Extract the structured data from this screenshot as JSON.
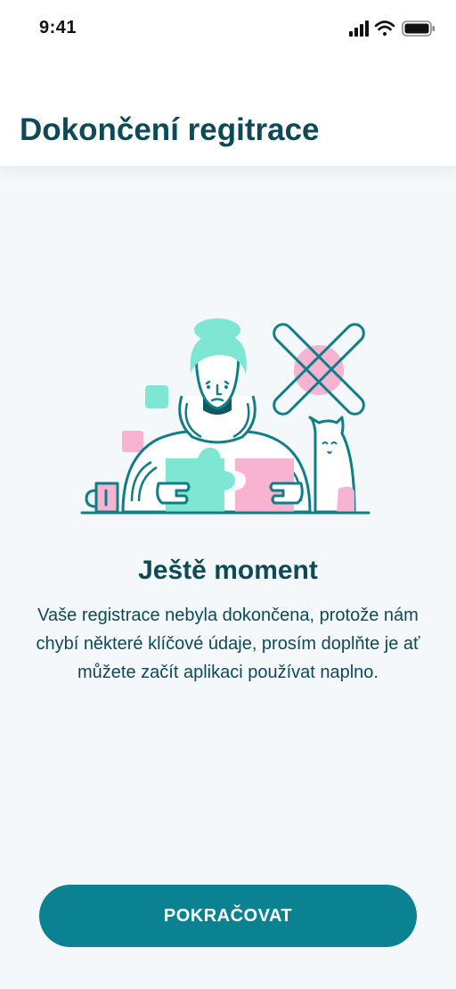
{
  "status_bar": {
    "time": "9:41",
    "icons": [
      "cellular-signal-icon",
      "wifi-icon",
      "battery-icon"
    ]
  },
  "header": {
    "title": "Dokončení regitrace"
  },
  "illustration": {
    "icon": "person-with-puzzle-and-cat-illustration"
  },
  "content": {
    "headline": "Ještě moment",
    "description": "Vaše registrace nebyla dokončena, protože nám chybí některé klíčové údaje, prosím doplňte je ať můžete začít aplikaci používat naplno."
  },
  "actions": {
    "continue_label": "POKRAČOVAT"
  },
  "colors": {
    "primary": "#0b8292",
    "text": "#0b4a56",
    "background": "#f5f8fa",
    "mint": "#7fe6d3",
    "pink": "#f7b3cf"
  }
}
